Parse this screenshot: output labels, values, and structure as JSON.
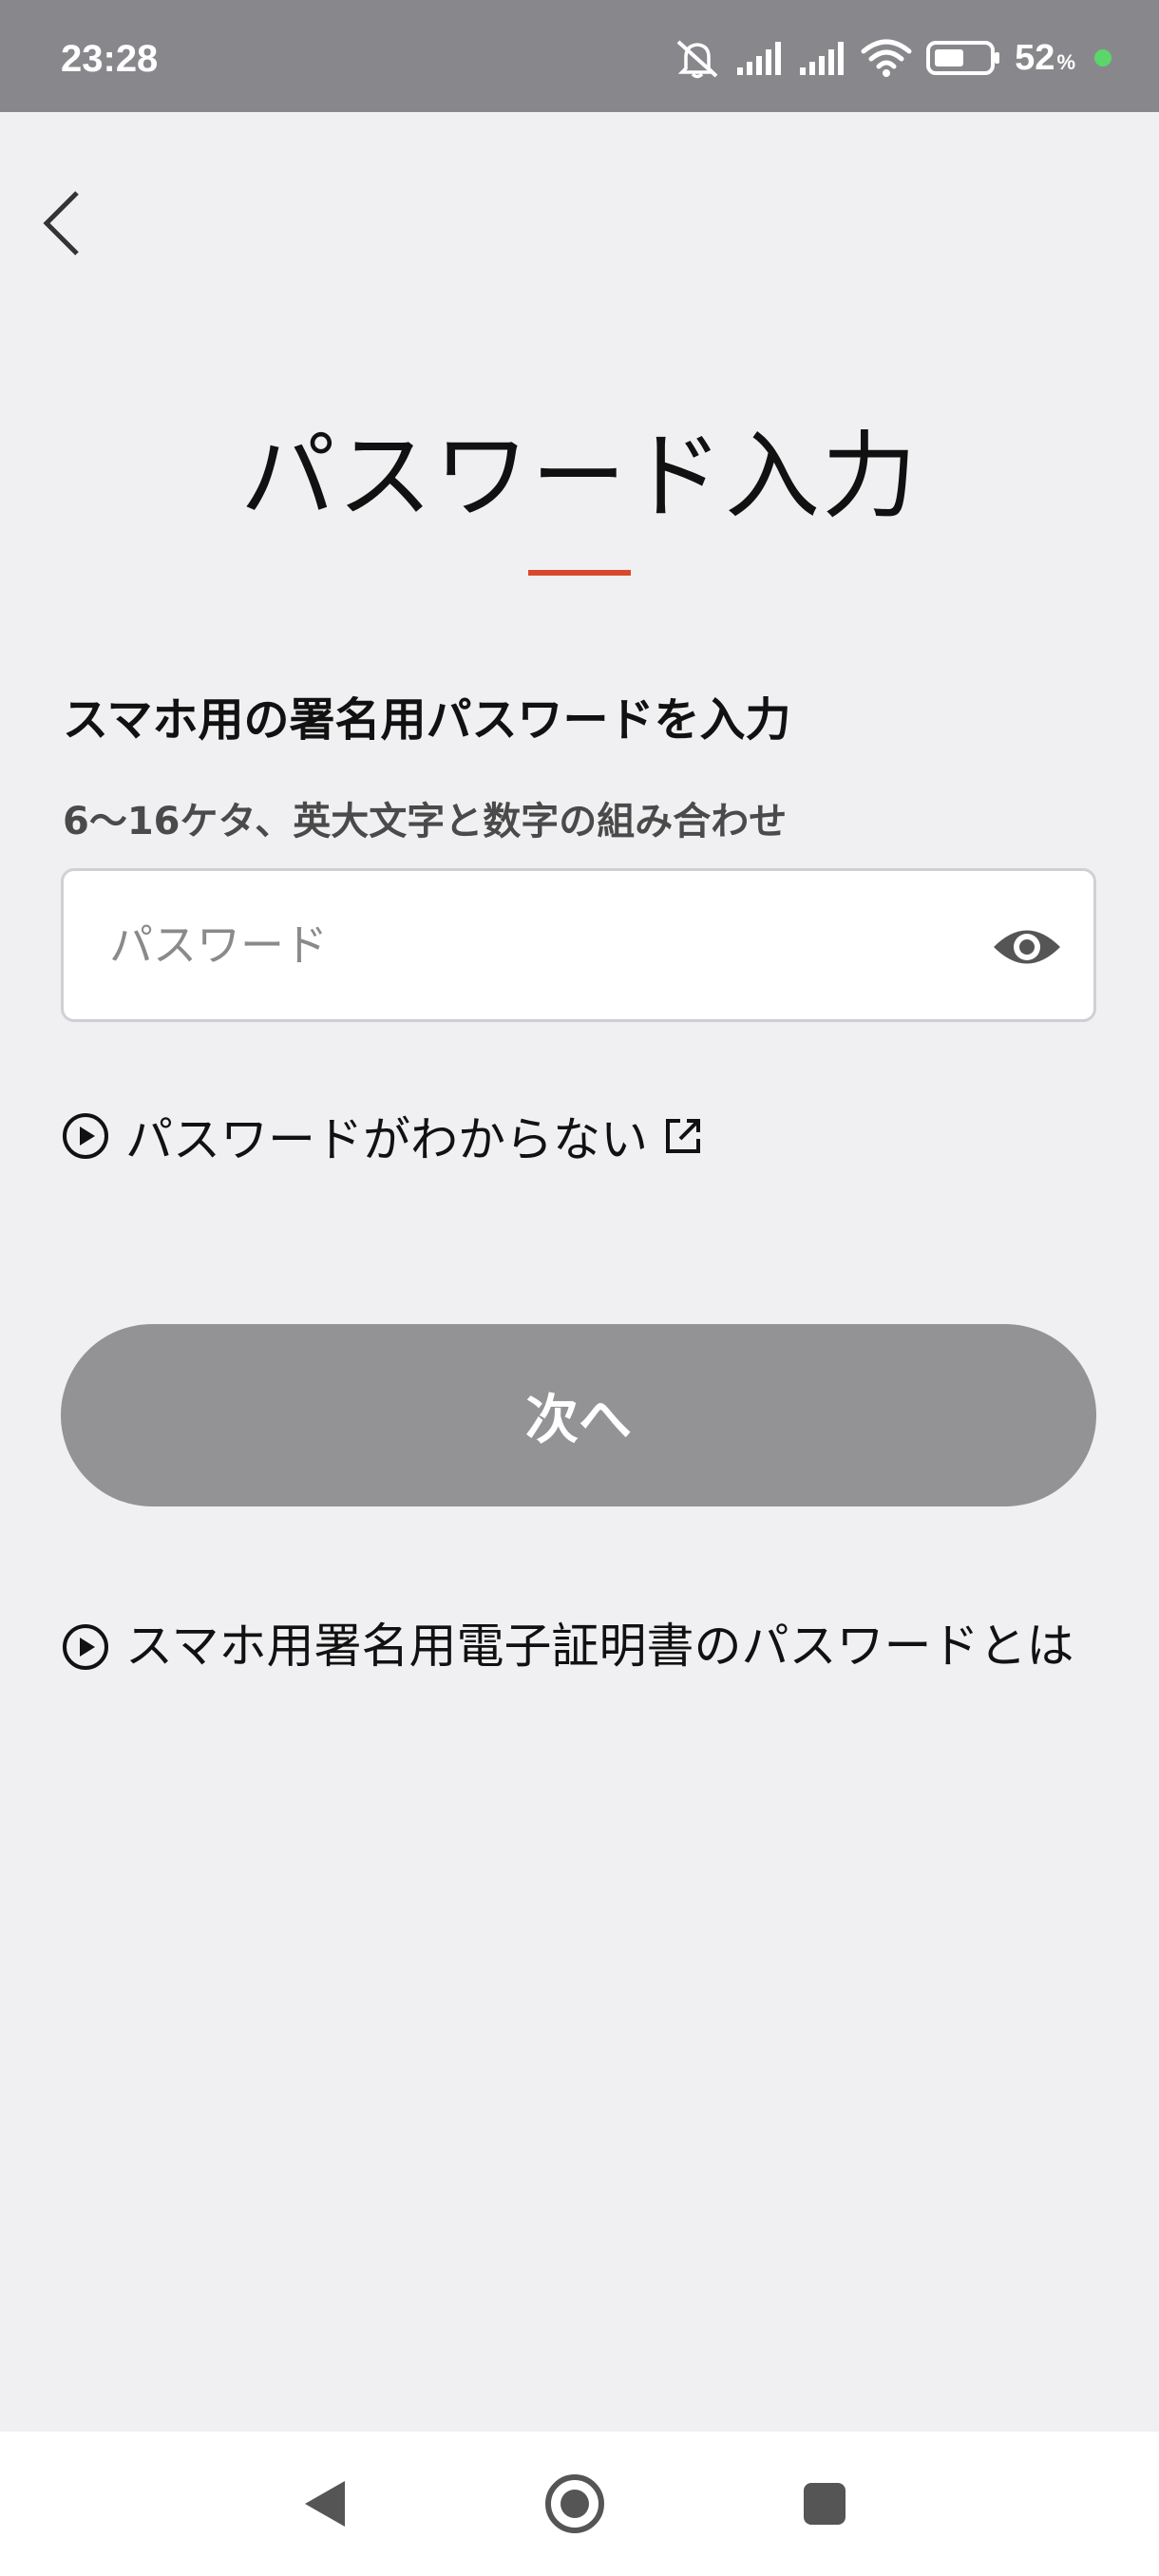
{
  "status_bar": {
    "time": "23:28",
    "battery_percent": "52",
    "battery_percent_sign": "%",
    "icons": [
      "mute-icon",
      "signal-icon",
      "signal-icon",
      "wifi-icon",
      "battery-icon"
    ],
    "charging_dot_color": "#5bd66a"
  },
  "header": {
    "back_icon": "chevron-left-icon",
    "title": "パスワード入力",
    "accent_color": "#d9482b"
  },
  "form": {
    "heading": "スマホ用の署名用パスワードを入力",
    "requirement": "6〜16ケタ、英大文字と数字の組み合わせ",
    "password_placeholder": "パスワード",
    "password_value": "",
    "visibility_icon": "eye-icon"
  },
  "links": {
    "forgot_password": "パスワードがわからない",
    "forgot_icon": "play-circle-icon",
    "external_icon": "external-link-icon",
    "about_password": "スマホ用署名用電子証明書のパスワードとは",
    "about_icon": "play-circle-icon"
  },
  "actions": {
    "next_label": "次へ",
    "next_button_color": "#939396"
  },
  "nav_bar": {
    "icons": [
      "back-triangle-icon",
      "home-circle-icon",
      "recents-square-icon"
    ]
  }
}
